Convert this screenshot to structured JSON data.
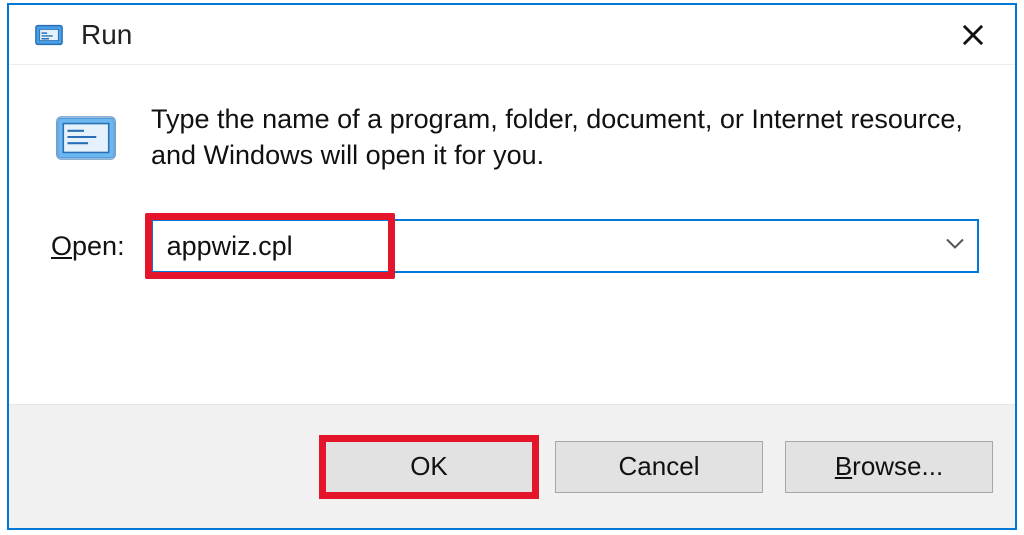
{
  "title": "Run",
  "description": "Type the name of a program, folder, document, or Internet resource, and Windows will open it for you.",
  "open_label_letter": "O",
  "open_label_rest": "pen:",
  "input_value": "appwiz.cpl",
  "buttons": {
    "ok": "OK",
    "cancel": "Cancel",
    "browse_letter": "B",
    "browse_rest": "rowse..."
  },
  "icons": {
    "app": "run-icon",
    "close": "close-icon",
    "dropdown": "chevron-down-icon",
    "big": "run-icon-large"
  }
}
